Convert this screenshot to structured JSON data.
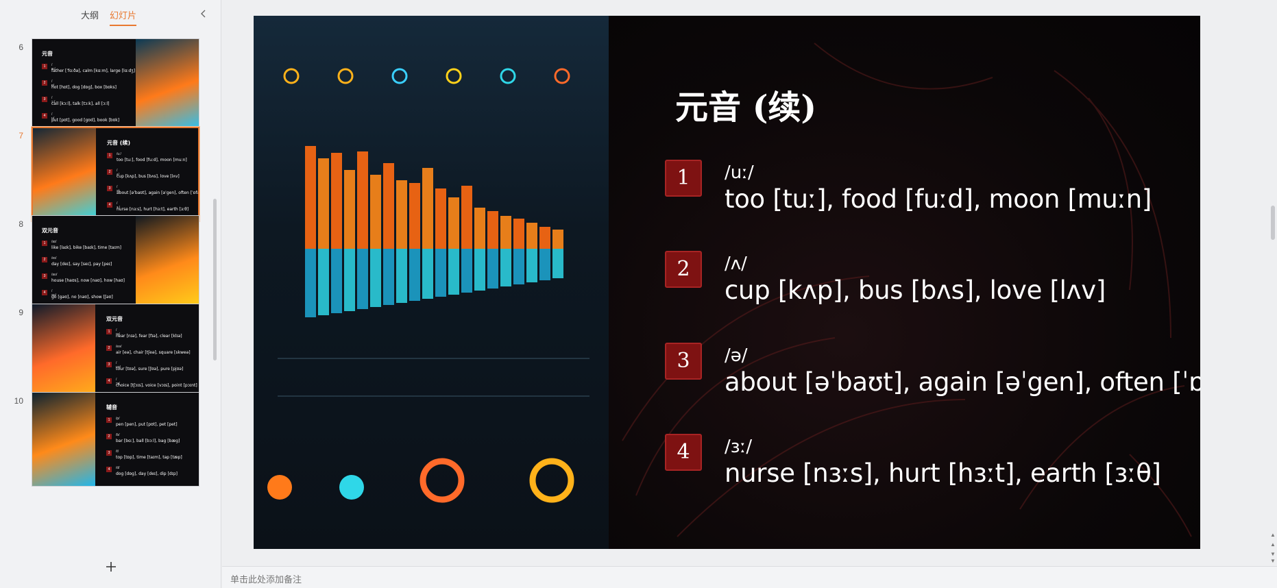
{
  "tabs": [
    {
      "label": "大纲",
      "active": false
    },
    {
      "label": "幻灯片",
      "active": true
    }
  ],
  "thumbnails": [
    {
      "number": "6",
      "title": "元音",
      "layout": "image-right",
      "img_colors": [
        "#0b3a56",
        "#ff7a1a",
        "#1ec6ff"
      ],
      "items": [
        {
          "n": "1",
          "ph": "/ɑː/",
          "ex": "father [ˈfɑːðə], calm [kɑːm], large [lɑːdʒ]"
        },
        {
          "n": "2",
          "ph": "/ɒ/",
          "ex": "hot [hɒt], dog [dɒg], box [bɒks]"
        },
        {
          "n": "3",
          "ph": "/ɔː/",
          "ex": "call [kɔːl], talk [tɔːk], all [ɔːl]"
        },
        {
          "n": "4",
          "ph": "/ʊ/",
          "ex": "put [pʊt], good [gʊd], book [bʊk]"
        }
      ]
    },
    {
      "number": "7",
      "title": "元音 (续)",
      "layout": "image-left",
      "img_colors": [
        "#132736",
        "#ff7a1a",
        "#2fd7e8"
      ],
      "items": [
        {
          "n": "1",
          "ph": "/uː/",
          "ex": "too [tuː], food [fuːd], moon [muːn]"
        },
        {
          "n": "2",
          "ph": "/ʌ/",
          "ex": "cup [kʌp], bus [bʌs], love [lʌv]"
        },
        {
          "n": "3",
          "ph": "/ə/",
          "ex": "about [əˈbaʊt], again [əˈgen], often [ˈɒfən]"
        },
        {
          "n": "4",
          "ph": "/ɜː/",
          "ex": "nurse [nɜːs], hurt [hɜːt], earth [ɜːθ]"
        }
      ]
    },
    {
      "number": "8",
      "title": "双元音",
      "layout": "image-right",
      "img_colors": [
        "#101820",
        "#ff8a1a",
        "#ffd21a"
      ],
      "items": [
        {
          "n": "1",
          "ph": "/aɪ/",
          "ex": "like [laɪk], bike [baɪk], time [taɪm]"
        },
        {
          "n": "2",
          "ph": "/eɪ/",
          "ex": "day [deɪ], say [seɪ], pay [peɪ]"
        },
        {
          "n": "3",
          "ph": "/aʊ/",
          "ex": "house [haʊs], now [naʊ], how [haʊ]"
        },
        {
          "n": "4",
          "ph": "/əʊ/",
          "ex": "go [gəʊ], no [nəʊ], show [ʃəʊ]"
        }
      ]
    },
    {
      "number": "9",
      "title": "双元音",
      "layout": "image-left",
      "img_colors": [
        "#0e1a2a",
        "#ff6a2a",
        "#ffb21a"
      ],
      "items": [
        {
          "n": "1",
          "ph": "/ɪə/",
          "ex": "near [nɪə], fear [fɪə], clear [klɪə]"
        },
        {
          "n": "2",
          "ph": "/eə/",
          "ex": "air [eə], chair [tʃeə], square [skweə]"
        },
        {
          "n": "3",
          "ph": "/ʊə/",
          "ex": "tour [tʊə], sure [ʃʊə], pure [pjʊə]"
        },
        {
          "n": "4",
          "ph": "/ɔɪ/",
          "ex": "choice [tʃɔɪs], voice [vɔɪs], point [pɔɪnt]"
        }
      ]
    },
    {
      "number": "10",
      "title": "辅音",
      "layout": "image-left",
      "img_colors": [
        "#0c2230",
        "#ff8a1a",
        "#22b6ea"
      ],
      "items": [
        {
          "n": "1",
          "ph": "/p/",
          "ex": "pen [pen], put [pʊt], pet [pet]"
        },
        {
          "n": "2",
          "ph": "/b/",
          "ex": "bar [bɑː], ball [bɔːl], bag [bæg]"
        },
        {
          "n": "3",
          "ph": "/t/",
          "ex": "top [tɒp], time [taɪm], tap [tæp]"
        },
        {
          "n": "4",
          "ph": "/d/",
          "ex": "dog [dɒg], day [deɪ], dip [dɪp]"
        }
      ]
    }
  ],
  "slide": {
    "title": "元音 (续)",
    "items": [
      {
        "number": "1",
        "phoneme": "/uː/",
        "examples": "too [tuː], food [fuːd], moon [muːn]"
      },
      {
        "number": "2",
        "phoneme": "/ʌ/",
        "examples": "cup [kʌp], bus [bʌs], love [lʌv]"
      },
      {
        "number": "3",
        "phoneme": "/ə/",
        "examples": "about [əˈbaʊt], again [əˈgen], often [ˈɒfən]"
      },
      {
        "number": "4",
        "phoneme": "/ɜː/",
        "examples": "nurse [nɜːs], hurt [hɜːt], earth [ɜːθ]"
      }
    ]
  },
  "notes_placeholder": "单击此处添加备注",
  "colors": {
    "accent": "#e8782f",
    "badge": "#7e1212",
    "slide_bg": "#0a0709"
  },
  "icons": [
    "collapse-chevron-icon",
    "add-slide-icon",
    "scroll-up-icon",
    "scroll-down-icon"
  ]
}
